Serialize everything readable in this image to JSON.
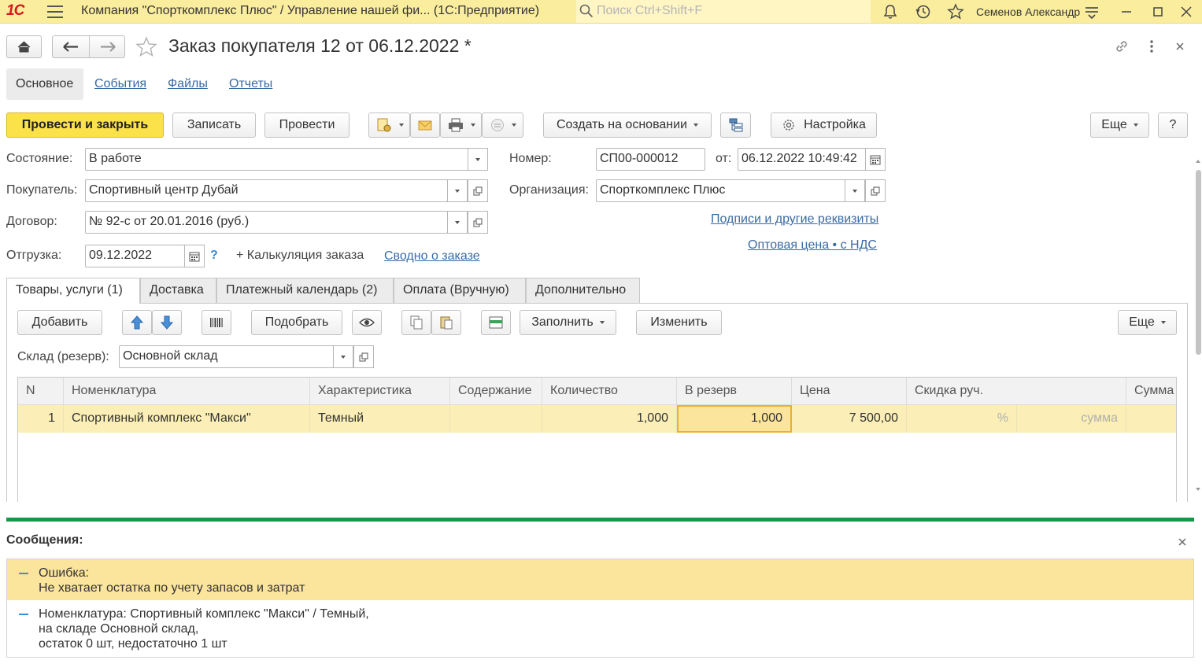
{
  "app": {
    "logo": "1С",
    "title": "Компания \"Спорткомплекс Плюс\" / Управление нашей фи...  (1С:Предприятие)",
    "search_placeholder": "Поиск Ctrl+Shift+F",
    "user": "Семенов Александр"
  },
  "document": {
    "title": "Заказ покупателя 12 от 06.12.2022 *"
  },
  "section_tabs": {
    "main": "Основное",
    "links": [
      "События",
      "Файлы",
      "Отчеты"
    ]
  },
  "toolbar": {
    "post_close": "Провести и закрыть",
    "save": "Записать",
    "post": "Провести",
    "create_based": "Создать на основании",
    "settings": "Настройка",
    "more": "Еще",
    "help": "?"
  },
  "form": {
    "state_label": "Состояние:",
    "state_value": "В работе",
    "buyer_label": "Покупатель:",
    "buyer_value": "Спортивный центр Дубай",
    "contract_label": "Договор:",
    "contract_value": "№ 92-с от 20.01.2016 (руб.)",
    "shipment_label": "Отгрузка:",
    "shipment_value": "09.12.2022",
    "shipment_help": "?",
    "calc": "+ Калькуляция заказа",
    "summary_link": "Сводно о заказе",
    "number_label": "Номер:",
    "number_value": "СП00-000012",
    "from_label": "от:",
    "date_value": "06.12.2022 10:49:42",
    "org_label": "Организация:",
    "org_value": "Спорткомплекс Плюс",
    "signatures_link": "Подписи и другие реквизиты",
    "price_link": "Оптовая цена • с НДС"
  },
  "inner_tabs": [
    "Товары, услуги (1)",
    "Доставка",
    "Платежный календарь (2)",
    "Оплата (Вручную)",
    "Дополнительно"
  ],
  "goods_toolbar": {
    "add": "Добавить",
    "pick": "Подобрать",
    "fill": "Заполнить",
    "change": "Изменить",
    "more": "Еще",
    "warehouse_label": "Склад (резерв):",
    "warehouse_value": "Основной склад"
  },
  "table": {
    "columns": [
      "N",
      "Номенклатура",
      "Характеристика",
      "Содержание",
      "Количество",
      "В резерв",
      "Цена",
      "Скидка руч.",
      "Сумма"
    ],
    "rows": [
      {
        "n": "1",
        "item": "Спортивный комплекс \"Макси\"",
        "char": "Темный",
        "content": "",
        "qty": "1,000",
        "reserve": "1,000",
        "price": "7 500,00",
        "disc_pct": "%",
        "disc_sum": "сумма"
      }
    ]
  },
  "messages": {
    "title": "Сообщения:",
    "error_title": "Ошибка:",
    "error_text": "Не хватает остатка по учету запасов и затрат",
    "detail_1": "Номенклатура: Спортивный комплекс \"Макси\" / Темный,",
    "detail_2": "на складе Основной склад,",
    "detail_3": "остаток 0 шт, недостаточно 1 шт"
  },
  "colors": {
    "topbar": "#fbed9e",
    "primary_button": "#fbe24a",
    "link": "#3a6aa4",
    "selected_row": "#fbeeb6",
    "divider": "#18964a",
    "error_bg": "#fbe49c"
  }
}
